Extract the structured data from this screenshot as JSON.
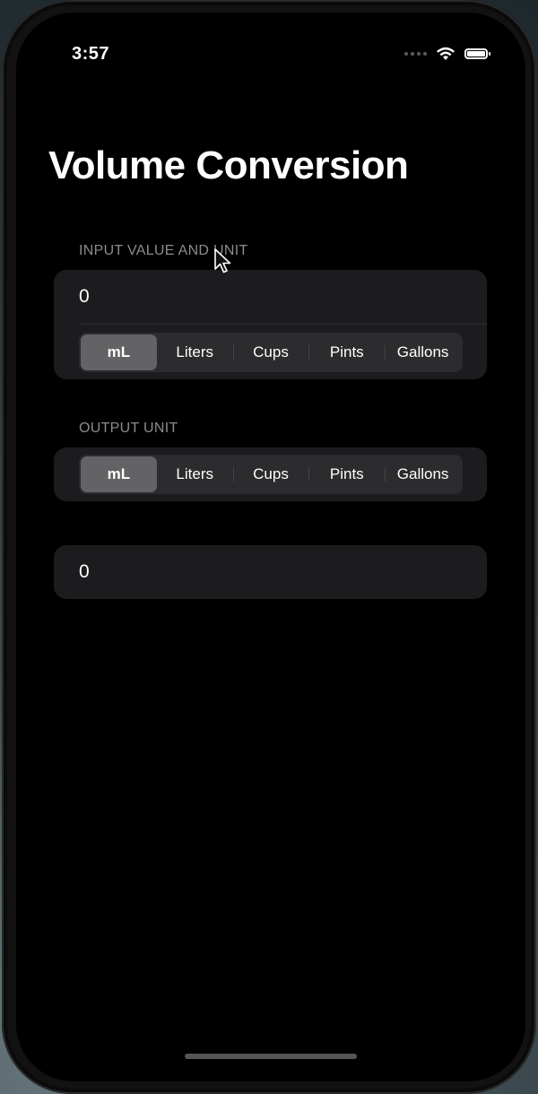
{
  "status_bar": {
    "time": "3:57",
    "icons": [
      "signal-dots-icon",
      "wifi-icon",
      "battery-icon"
    ]
  },
  "title": "Volume Conversion",
  "input_section": {
    "header": "INPUT VALUE AND UNIT",
    "value": "0",
    "units": [
      "mL",
      "Liters",
      "Cups",
      "Pints",
      "Gallons"
    ],
    "selected_unit": "mL"
  },
  "output_section": {
    "header": "OUTPUT UNIT",
    "units": [
      "mL",
      "Liters",
      "Cups",
      "Pints",
      "Gallons"
    ],
    "selected_unit": "mL"
  },
  "result": {
    "value": "0"
  },
  "colors": {
    "background": "#000000",
    "card": "#1c1c1e",
    "segment_track": "#2c2c2e",
    "segment_selected": "#636366",
    "header_text": "#8b8b90"
  }
}
